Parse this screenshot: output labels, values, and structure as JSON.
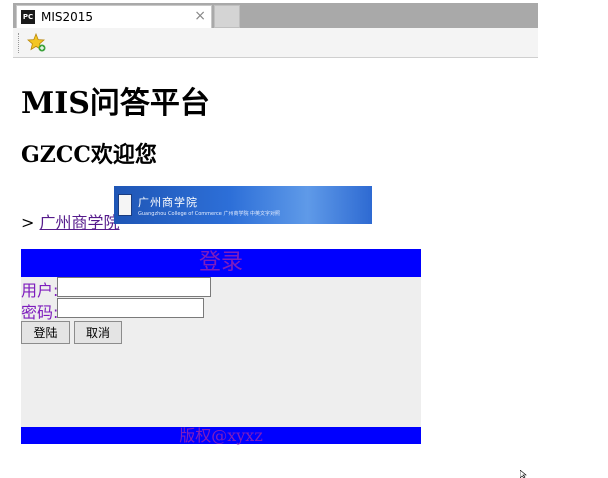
{
  "browser": {
    "tab_logo": "PC",
    "tab_title": "MIS2015",
    "tab_close": "×",
    "icons": [
      "favorites-star-icon",
      "close-icon"
    ]
  },
  "page": {
    "heading": "MIS问答平台",
    "subheading": "GZCC欢迎您",
    "link_prefix": "> ",
    "link_text": "广州商学院",
    "banner_title": "广州商学院",
    "banner_sub": "Guangzhou College of Commerce 广州商学院 中英文字对照"
  },
  "login": {
    "title": "登录",
    "user_label": "用户:",
    "user_value": "",
    "password_label": "密码:",
    "password_value": "",
    "submit_label": "登陆",
    "cancel_label": "取消"
  },
  "footer": {
    "text": "版权@xyxz"
  },
  "colors": {
    "panel_blue": "#0000ff",
    "purple_text": "#7e1dbd",
    "panel_gray": "#eeeeee"
  }
}
